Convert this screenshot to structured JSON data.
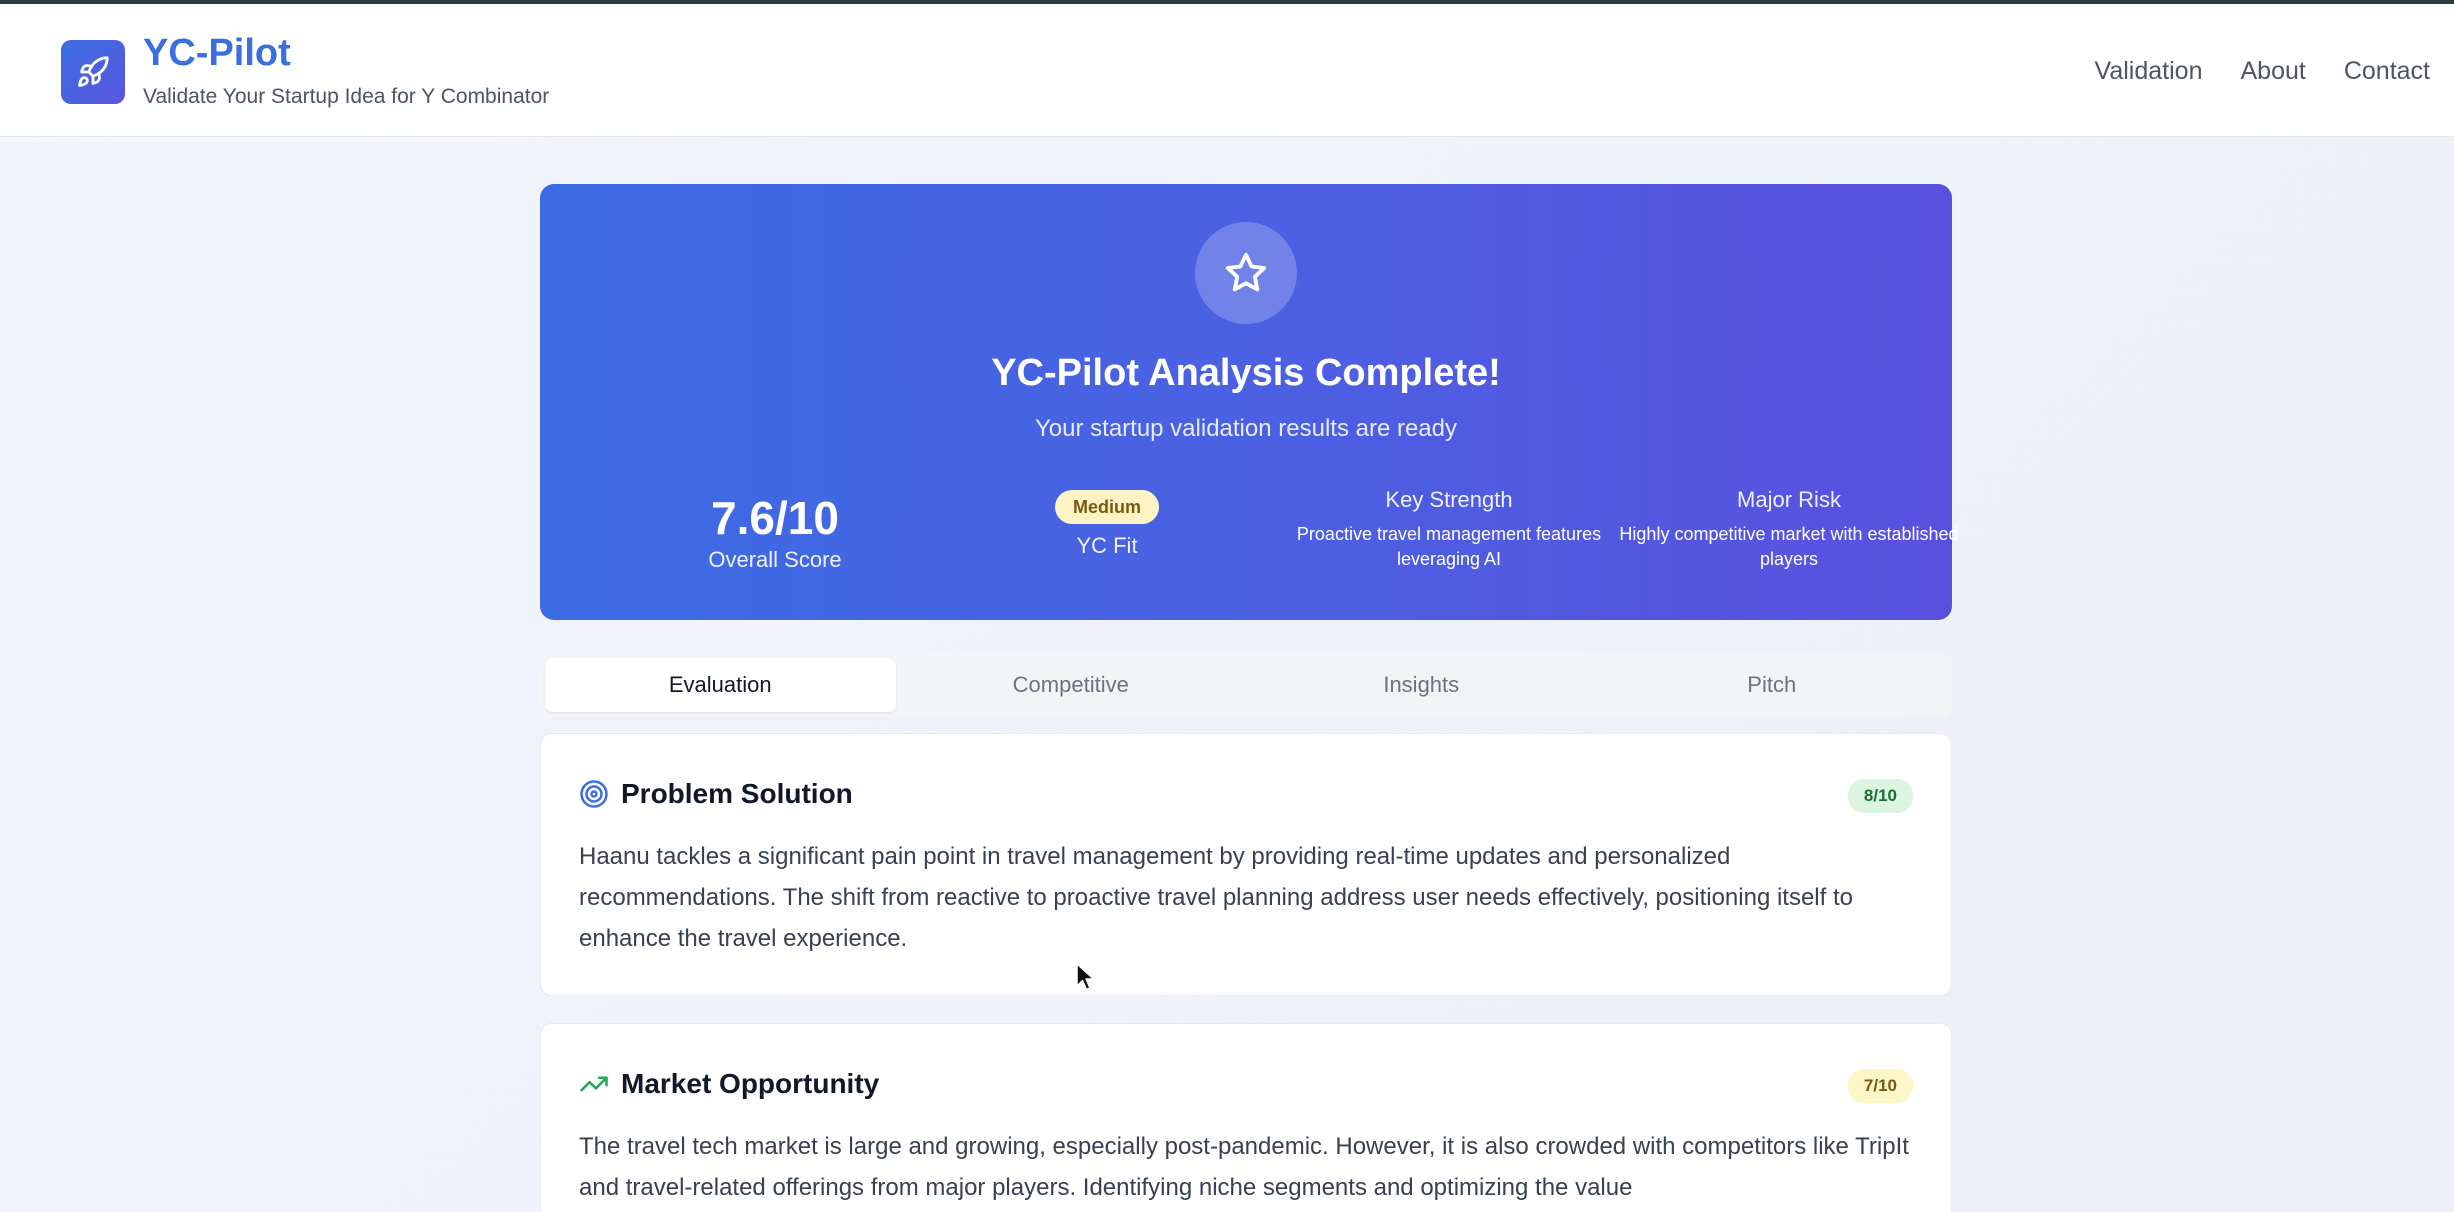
{
  "header": {
    "brand_title": "YC-Pilot",
    "brand_subtitle": "Validate Your Startup Idea for Y Combinator",
    "logo_icon": "rocket-icon",
    "nav": [
      "Validation",
      "About",
      "Contact"
    ]
  },
  "hero": {
    "icon": "star-icon",
    "title": "YC-Pilot Analysis Complete!",
    "subtitle": "Your startup validation results are ready",
    "overall_score": "7.6/10",
    "overall_score_label": "Overall Score",
    "yc_fit_badge": "Medium",
    "yc_fit_label": "YC Fit",
    "key_strength_label": "Key Strength",
    "key_strength_text": "Proactive travel management features leveraging AI",
    "major_risk_label": "Major Risk",
    "major_risk_text": "Highly competitive market with established players"
  },
  "tabs": [
    "Evaluation",
    "Competitive",
    "Insights",
    "Pitch"
  ],
  "active_tab": "Evaluation",
  "cards": [
    {
      "icon": "target-icon",
      "title": "Problem Solution",
      "score": "8/10",
      "body": "Haanu tackles a significant pain point in travel management by providing real-time updates and personalized recommendations. The shift from reactive to proactive travel planning address user needs effectively, positioning itself to enhance the travel experience."
    },
    {
      "icon": "trending-up-icon",
      "title": "Market Opportunity",
      "score": "7/10",
      "body": "The travel tech market is large and growing, especially post-pandemic. However, it is also crowded with competitors like TripIt and travel-related offerings from major players. Identifying niche segments and optimizing the value"
    }
  ],
  "colors": {
    "brand_blue": "#3b6fe0",
    "hero_gradient_start": "#3c6ce3",
    "hero_gradient_end": "#5a50df",
    "score_green_bg": "#dcf5e3",
    "score_yellow_bg": "#fdf6c9"
  }
}
